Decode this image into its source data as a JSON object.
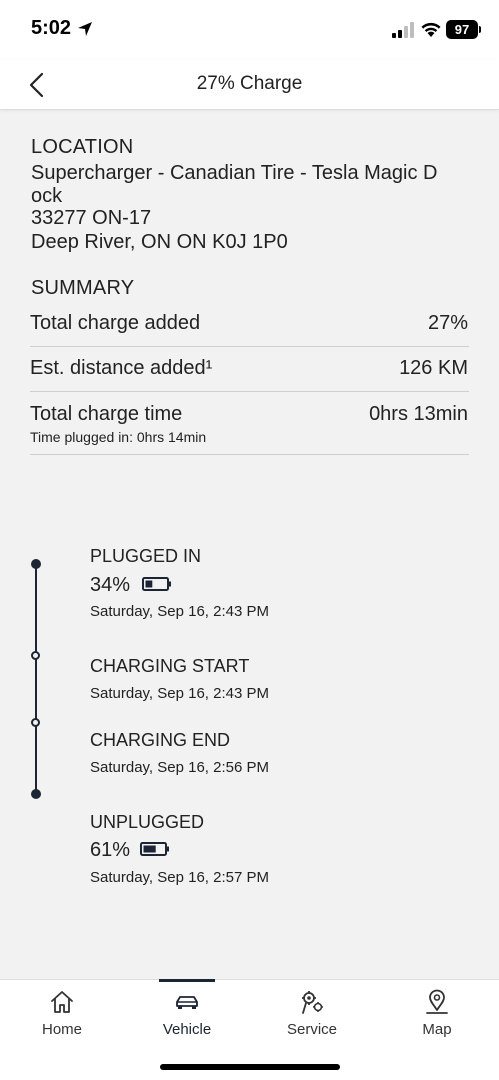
{
  "status_bar": {
    "time": "5:02",
    "battery": "97"
  },
  "nav": {
    "title": "27% Charge"
  },
  "location": {
    "heading": "LOCATION",
    "name_line1": "Supercharger - Canadian Tire - Tesla Magic D",
    "name_line2": "ock",
    "street": "33277 ON-17",
    "city": "Deep River, ON ON K0J 1P0"
  },
  "summary": {
    "heading": "SUMMARY",
    "rows": [
      {
        "label": "Total charge added",
        "value": "27%"
      },
      {
        "label": "Est. distance added¹",
        "value": "126 KM"
      },
      {
        "label": "Total charge time",
        "value": "0hrs 13min",
        "sub": "Time plugged in: 0hrs 14min"
      }
    ]
  },
  "timeline": [
    {
      "title": "PLUGGED IN",
      "percent": "34%",
      "battery_level": 0.34,
      "date": "Saturday, Sep 16, 2:43 PM"
    },
    {
      "title": "CHARGING START",
      "date": "Saturday, Sep 16, 2:43 PM"
    },
    {
      "title": "CHARGING END",
      "date": "Saturday, Sep 16, 2:56 PM"
    },
    {
      "title": "UNPLUGGED",
      "percent": "61%",
      "battery_level": 0.61,
      "date": "Saturday, Sep 16, 2:57 PM"
    }
  ],
  "tabs": [
    {
      "label": "Home",
      "icon": "home-icon"
    },
    {
      "label": "Vehicle",
      "icon": "car-icon",
      "active": true
    },
    {
      "label": "Service",
      "icon": "service-icon"
    },
    {
      "label": "Map",
      "icon": "map-pin-icon"
    }
  ],
  "colors": {
    "accent": "#1c2533",
    "background": "#f2f2f2"
  }
}
